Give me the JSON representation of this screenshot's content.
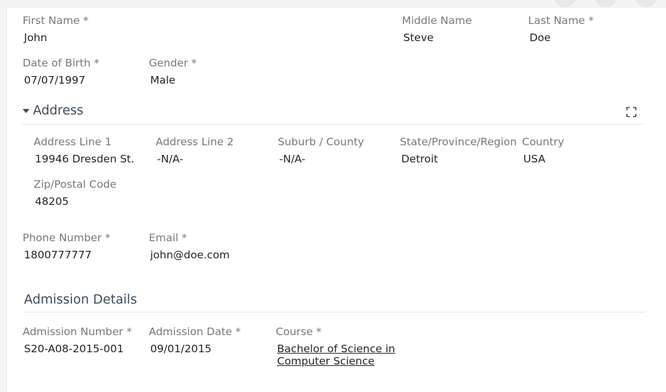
{
  "personal": {
    "first_name": {
      "label": "First Name *",
      "value": "John"
    },
    "middle_name": {
      "label": "Middle Name",
      "value": "Steve"
    },
    "last_name": {
      "label": "Last Name *",
      "value": "Doe"
    },
    "dob": {
      "label": "Date of Birth *",
      "value": "07/07/1997"
    },
    "gender": {
      "label": "Gender *",
      "value": "Male"
    }
  },
  "address": {
    "title": "Address",
    "line1": {
      "label": "Address Line 1",
      "value": "19946 Dresden St."
    },
    "line2": {
      "label": "Address Line 2",
      "value": "-N/A-"
    },
    "suburb": {
      "label": "Suburb / County",
      "value": "-N/A-"
    },
    "state": {
      "label": "State/Province/Region",
      "value": "Detroit"
    },
    "country": {
      "label": "Country",
      "value": "USA"
    },
    "zip": {
      "label": "Zip/Postal Code",
      "value": "48205"
    },
    "expand_icon": "expand-icon"
  },
  "contact": {
    "phone": {
      "label": "Phone Number *",
      "value": "1800777777"
    },
    "email": {
      "label": "Email *",
      "value": "john@doe.com"
    }
  },
  "admission": {
    "title": "Admission Details",
    "number": {
      "label": "Admission Number *",
      "value": "S20-A08-2015-001"
    },
    "date": {
      "label": "Admission Date *",
      "value": "09/01/2015"
    },
    "course": {
      "label": "Course *",
      "value": "Bachelor of Science in Computer Science"
    }
  }
}
